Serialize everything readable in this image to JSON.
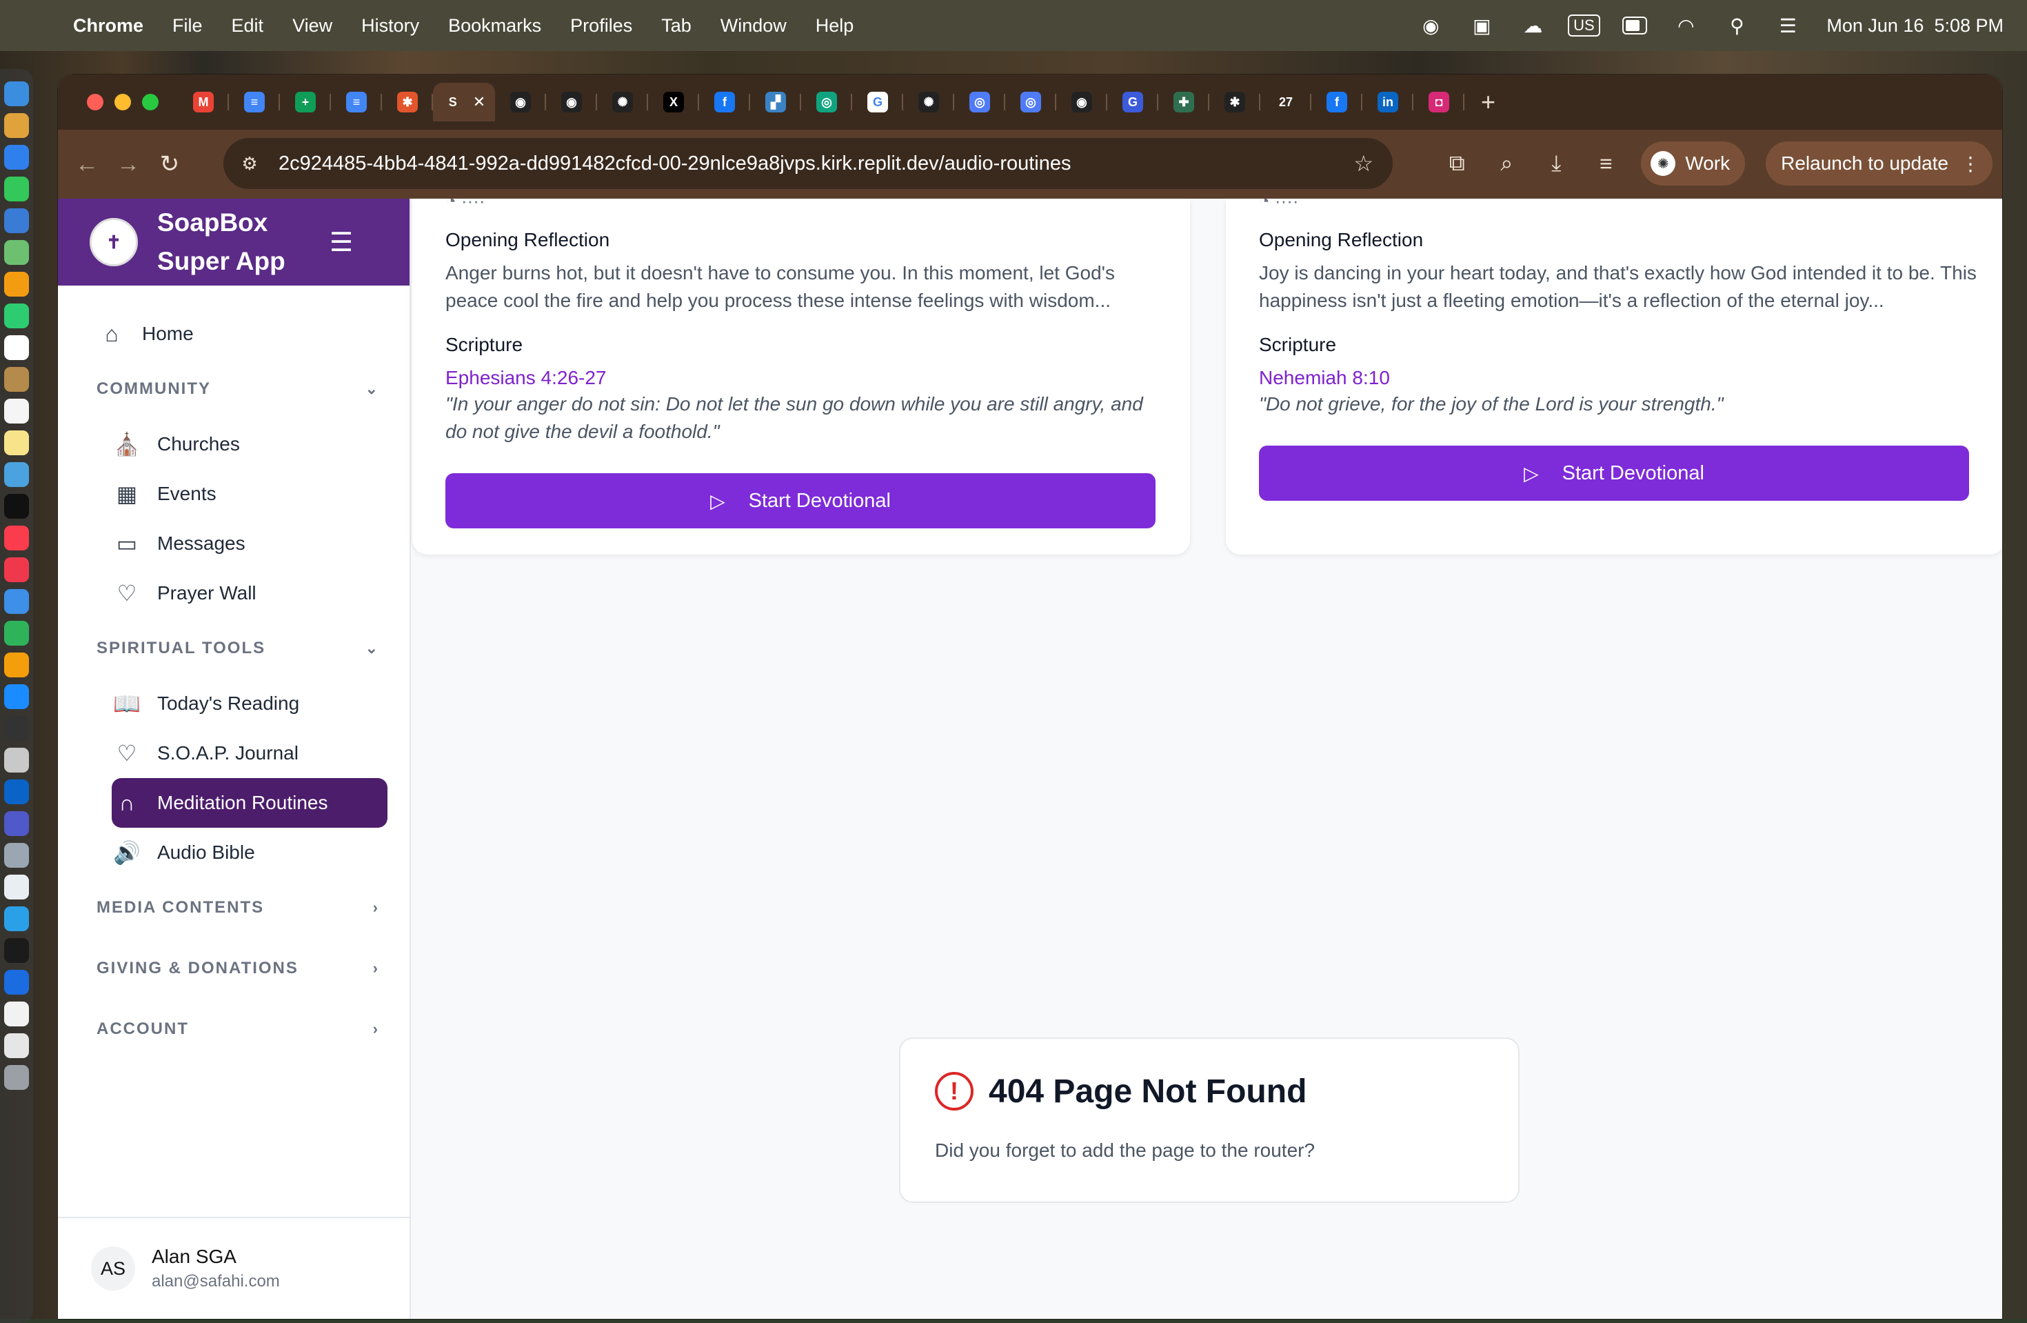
{
  "menubar": {
    "app": "Chrome",
    "items": [
      "File",
      "Edit",
      "View",
      "History",
      "Bookmarks",
      "Profiles",
      "Tab",
      "Window",
      "Help"
    ],
    "input_source": "US",
    "datetime": "Mon Jun 16  5:08 PM"
  },
  "browser": {
    "url": "2c924485-4bb4-4841-992a-dd991482cfcd-00-29nlce9a8jvps.kirk.replit.dev/audio-routines",
    "profile": "Work",
    "relaunch": "Relaunch to update",
    "tabs": [
      {
        "icon": "gmail-icon",
        "color": "#ea4335",
        "glyph": "M"
      },
      {
        "icon": "docs-icon",
        "color": "#4285f4",
        "glyph": "≡"
      },
      {
        "icon": "sheets-icon",
        "color": "#0f9d58",
        "glyph": "+"
      },
      {
        "icon": "docs-icon",
        "color": "#4285f4",
        "glyph": "≡"
      },
      {
        "icon": "app-icon",
        "color": "#e2552d",
        "glyph": "✱"
      },
      {
        "icon": "soapbox-icon",
        "color": "#5a3e2b",
        "glyph": "S",
        "active": true
      },
      {
        "icon": "github-icon",
        "color": "#222222",
        "glyph": "◉"
      },
      {
        "icon": "github-icon",
        "color": "#222222",
        "glyph": "◉"
      },
      {
        "icon": "chatgpt-icon",
        "color": "#222222",
        "glyph": "✺"
      },
      {
        "icon": "x-icon",
        "color": "#000000",
        "glyph": "X"
      },
      {
        "icon": "facebook-icon",
        "color": "#1877f2",
        "glyph": "f"
      },
      {
        "icon": "app-icon",
        "color": "#3b82c4",
        "glyph": "▞"
      },
      {
        "icon": "app-icon",
        "color": "#10a37f",
        "glyph": "◎"
      },
      {
        "icon": "google-icon",
        "color": "#ffffff",
        "glyph": "G"
      },
      {
        "icon": "chatgpt-icon",
        "color": "#222222",
        "glyph": "✺"
      },
      {
        "icon": "app-icon",
        "color": "#4f7bf7",
        "glyph": "◎"
      },
      {
        "icon": "app-icon",
        "color": "#4f7bf7",
        "glyph": "◎"
      },
      {
        "icon": "github-icon",
        "color": "#222222",
        "glyph": "◉"
      },
      {
        "icon": "app-icon",
        "color": "#3b5bdb",
        "glyph": "G"
      },
      {
        "icon": "app-icon",
        "color": "#2f6f4f",
        "glyph": "✚"
      },
      {
        "icon": "app-icon",
        "color": "#222222",
        "glyph": "✱"
      },
      {
        "icon": "calendar-icon",
        "color": "#3a2a1e",
        "glyph": "27"
      },
      {
        "icon": "facebook-icon",
        "color": "#1877f2",
        "glyph": "f"
      },
      {
        "icon": "linkedin-icon",
        "color": "#0a66c2",
        "glyph": "in"
      },
      {
        "icon": "instagram-icon",
        "color": "#d62976",
        "glyph": "◘"
      }
    ]
  },
  "sidebar": {
    "brand": "SoapBox Super App",
    "home": "Home",
    "community": {
      "title": "COMMUNITY",
      "items": [
        "Churches",
        "Events",
        "Messages",
        "Prayer Wall"
      ]
    },
    "spiritual": {
      "title": "SPIRITUAL TOOLS",
      "items": [
        "Today's Reading",
        "S.O.A.P. Journal",
        "Meditation Routines",
        "Audio Bible"
      ]
    },
    "sections": [
      "MEDIA CONTENTS",
      "GIVING & DONATIONS",
      "ACCOUNT"
    ],
    "user": {
      "initials": "AS",
      "name": "Alan SGA",
      "email": "alan@safahi.com"
    }
  },
  "cards": [
    {
      "reflection_title": "Opening Reflection",
      "reflection": "Anger burns hot, but it doesn't have to consume you. In this moment, let God's peace cool the fire and help you process these intense feelings with wisdom...",
      "scripture_title": "Scripture",
      "reference": "Ephesians 4:26-27",
      "quote": "\"In your anger do not sin: Do not let the sun go down while you are still angry, and do not give the devil a foothold.\"",
      "button": "Start Devotional"
    },
    {
      "reflection_title": "Opening Reflection",
      "reflection": "Joy is dancing in your heart today, and that's exactly how God intended it to be. This happiness isn't just a fleeting emotion—it's a reflection of the eternal joy...",
      "scripture_title": "Scripture",
      "reference": "Nehemiah 8:10",
      "quote": "\"Do not grieve, for the joy of the Lord is your strength.\"",
      "button": "Start Devotional"
    }
  ],
  "not_found": {
    "title": "404 Page Not Found",
    "message": "Did you forget to add the page to the router?"
  },
  "colors": {
    "brand_purple": "#5b2b87",
    "active_nav": "#4c1d6b",
    "button_purple": "#7e2bd9",
    "reference_purple": "#7e22ce",
    "error_red": "#dc2626"
  }
}
